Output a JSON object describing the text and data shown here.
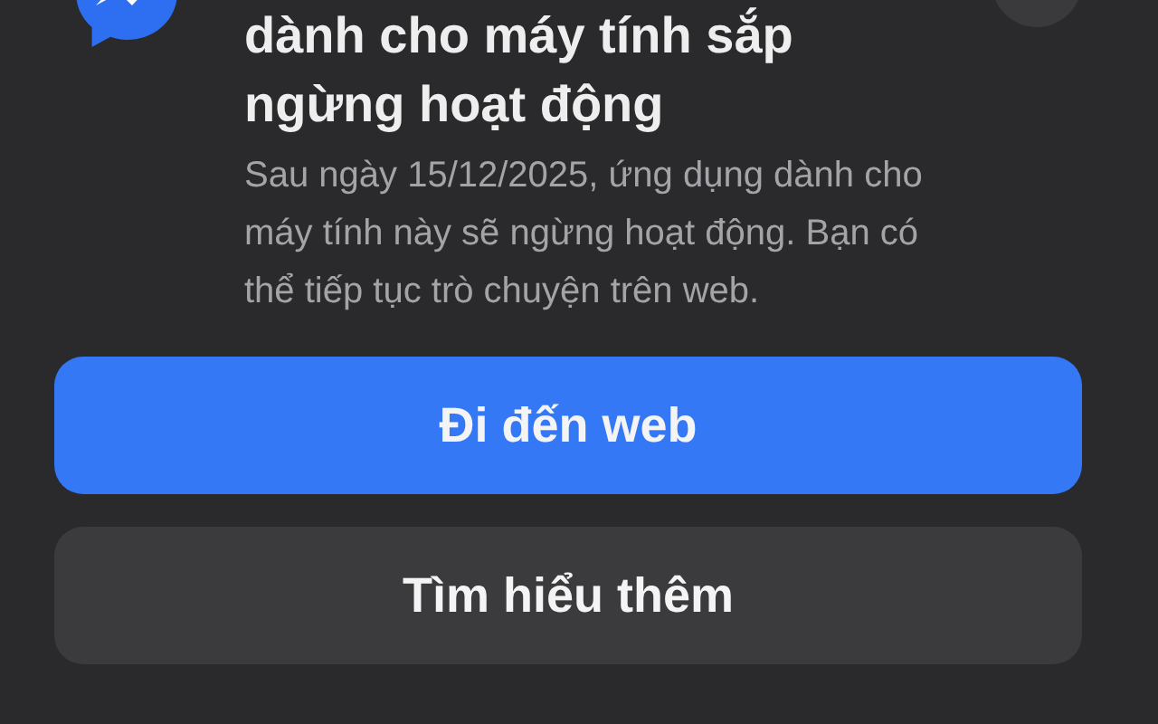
{
  "dialog": {
    "title": "dành cho máy tính sắp ngừng hoạt động",
    "message": "Sau ngày 15/12/2025, ứng dụng dành cho máy tính này sẽ ngừng hoạt động. Bạn có thể tiếp tục trò chuyện trên web.",
    "buttons": [
      {
        "label": "Đi đến web",
        "kind": "primary"
      },
      {
        "label": "Tìm hiểu thêm",
        "kind": "secondary"
      }
    ]
  }
}
